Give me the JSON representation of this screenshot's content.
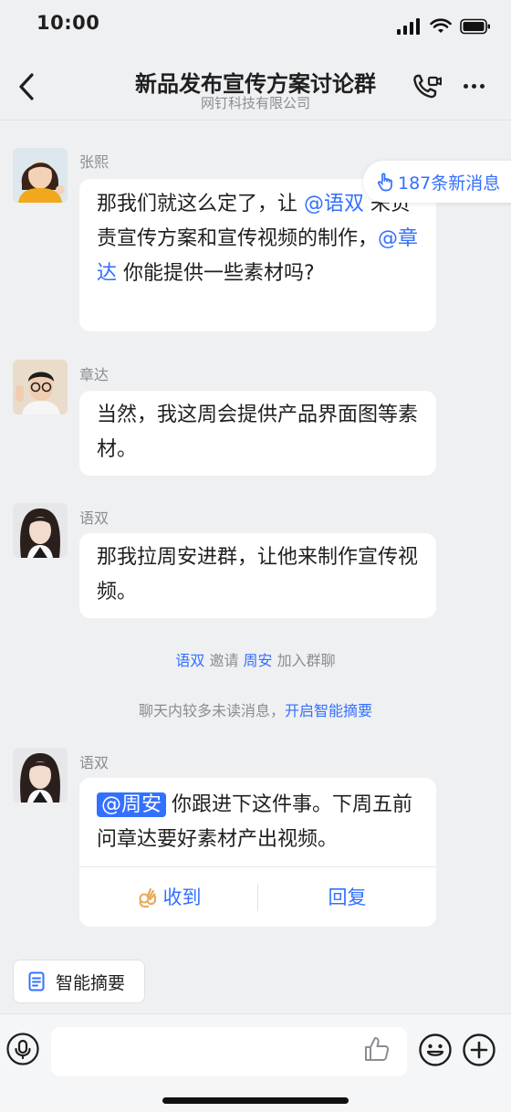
{
  "status_bar": {
    "time": "10:00"
  },
  "header": {
    "title": "新品发布宣传方案讨论群",
    "subtitle": "网钉科技有限公司"
  },
  "new_messages_pill": "187条新消息",
  "messages": [
    {
      "sender": "张熙",
      "parts": [
        "那我们就这么定了，让 ",
        "@语双",
        " 来负责宣传方案和宣传视频的制作，",
        "@章达",
        " 你能提供一些素材吗?"
      ]
    },
    {
      "sender": "章达",
      "text": "当然，我这周会提供产品界面图等素材。"
    },
    {
      "sender": "语双",
      "text": "那我拉周安进群，让他来制作宣传视频。"
    },
    {
      "sender": "语双",
      "mention": "@周安",
      "text": "你跟进下这件事。下周五前问章达要好素材产出视频。",
      "actions": {
        "ack": "收到",
        "reply": "回复"
      }
    }
  ],
  "system": {
    "invite": {
      "inviter": "语双",
      "verb": "邀请",
      "invitee": "周安",
      "suffix": "加入群聊"
    },
    "unread_notice": "聊天内较多未读消息，",
    "smart_summary_link": "开启智能摘要"
  },
  "summary_chip": "智能摘要",
  "colors": {
    "accent": "#3370ff",
    "background": "#eff0f2",
    "bubble": "#ffffff"
  }
}
